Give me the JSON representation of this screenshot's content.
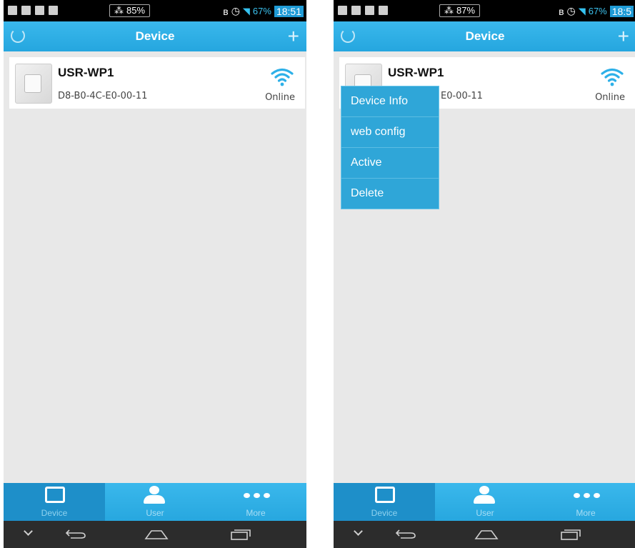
{
  "left": {
    "status_bar": {
      "battery_text": "85%",
      "battery_pct": "67%",
      "time": "18:51"
    },
    "header": {
      "title": "Device"
    },
    "device": {
      "name": "USR-WP1",
      "mac": "D8-B0-4C-E0-00-11",
      "status": "Online"
    },
    "tabs": [
      {
        "label": "Device"
      },
      {
        "label": "User"
      },
      {
        "label": "More"
      }
    ]
  },
  "right": {
    "status_bar": {
      "battery_text": "87%",
      "battery_pct": "67%",
      "time": "18:5"
    },
    "header": {
      "title": "Device"
    },
    "device": {
      "name": "USR-WP1",
      "mac": "E0-00-11",
      "status": "Online"
    },
    "context_menu": {
      "items": [
        "Device Info",
        "web config",
        "Active",
        "Delete"
      ]
    },
    "tabs": [
      {
        "label": "Device"
      },
      {
        "label": "User"
      },
      {
        "label": "More"
      }
    ]
  },
  "colors": {
    "accent": "#2fa6d8",
    "header": "#3ab8ec",
    "background": "#e8e8e8"
  },
  "icons": [
    "refresh-icon",
    "add-icon",
    "wifi-icon",
    "device-tab-icon",
    "user-tab-icon",
    "more-tab-icon",
    "chevron-down-icon",
    "back-icon",
    "home-icon",
    "recent-apps-icon"
  ]
}
